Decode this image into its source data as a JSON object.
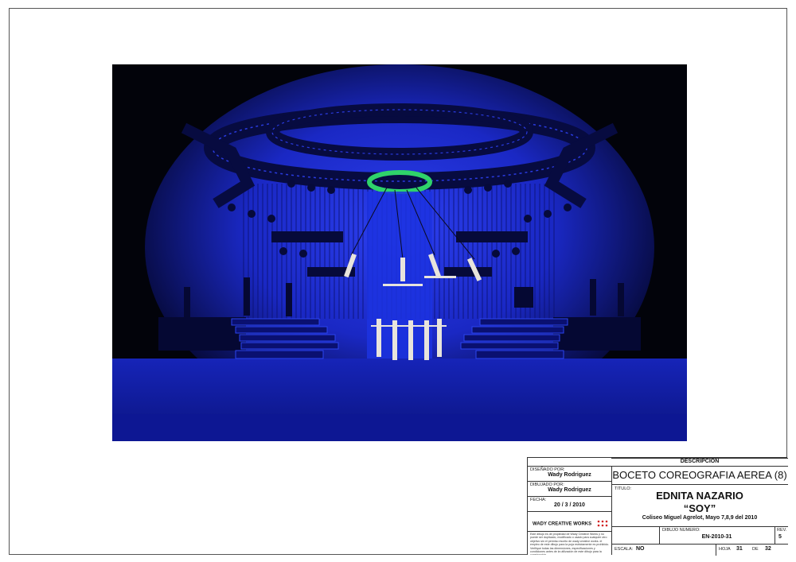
{
  "title_block": {
    "descripcion_label": "DESCRIPCION",
    "descripcion_value": "BOCETO COREOGRAFIA AEREA (8)",
    "disenado_label": "DISEÑADO POR:",
    "disenado_value": "Wady Rodriguez",
    "dibujado_label": "DIBUJADO POR:",
    "dibujado_value": "Wady Rodriguez",
    "fecha_label": "FECHA:",
    "fecha_value": "20 / 3 / 2010",
    "company": "WADY CREATIVE WORKS",
    "disclaimer": "Este dibujo es de propiedad de Wady Creative Works y no puede ser duplicado, modificado o usado para cualquier otro objetivo sin el permiso escrito de wady creative works. el empleo de este dibujo para la puja estrictamente es prohibido. Verifique todas las dimensiones, especificaciones y condiciones antes de la utilización de este dibujo para la construcción.",
    "titulo_label": "TITULO:",
    "artist": "EDNITA NAZARIO",
    "show": "“SOY”",
    "venue": "Coliseo Miguel Agrelot, Mayo 7,8,9 del 2010",
    "dibujo_numero_label": "DIBUJO NUMERO:",
    "dibujo_numero_value": "EN-2010-31",
    "rev_label": "REV.",
    "rev_value": "5",
    "escala_label": "ESCALA:",
    "escala_value": "NO",
    "hoja_label": "HOJA",
    "hoja_value": "31",
    "de_label": "DE",
    "de_value": "32"
  },
  "colors": {
    "stage_blue": "#1a2fd6",
    "deep_blue": "#0a126e",
    "ring_green": "#2fd36a"
  }
}
